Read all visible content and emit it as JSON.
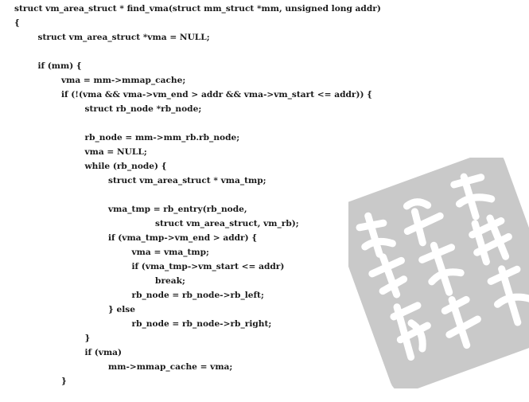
{
  "document": {
    "lines": [
      "struct vm_area_struct * find_vma(struct mm_struct *mm, unsigned long addr)",
      "{",
      "        struct vm_area_struct *vma = NULL;",
      "",
      "        if (mm) {",
      "                vma = mm->mmap_cache;",
      "                if (!(vma && vma->vm_end > addr && vma->vm_start <= addr)) {",
      "                        struct rb_node *rb_node;",
      "",
      "                        rb_node = mm->mm_rb.rb_node;",
      "                        vma = NULL;",
      "                        while (rb_node) {",
      "                                struct vm_area_struct * vma_tmp;",
      "",
      "                                vma_tmp = rb_entry(rb_node,",
      "                                                struct vm_area_struct, vm_rb);",
      "                                if (vma_tmp->vm_end > addr) {",
      "                                        vma = vma_tmp;",
      "                                        if (vma_tmp->vm_start <= addr)",
      "                                                break;",
      "                                        rb_node = rb_node->rb_left;",
      "                                } else",
      "                                        rb_node = rb_node->rb_right;",
      "                        }",
      "                        if (vma)",
      "                                mm->mmap_cache = vma;",
      "                }"
    ]
  },
  "watermark": {
    "kind": "seal-stamp",
    "color": "#c9c9c9",
    "ink": "#ffffff"
  }
}
